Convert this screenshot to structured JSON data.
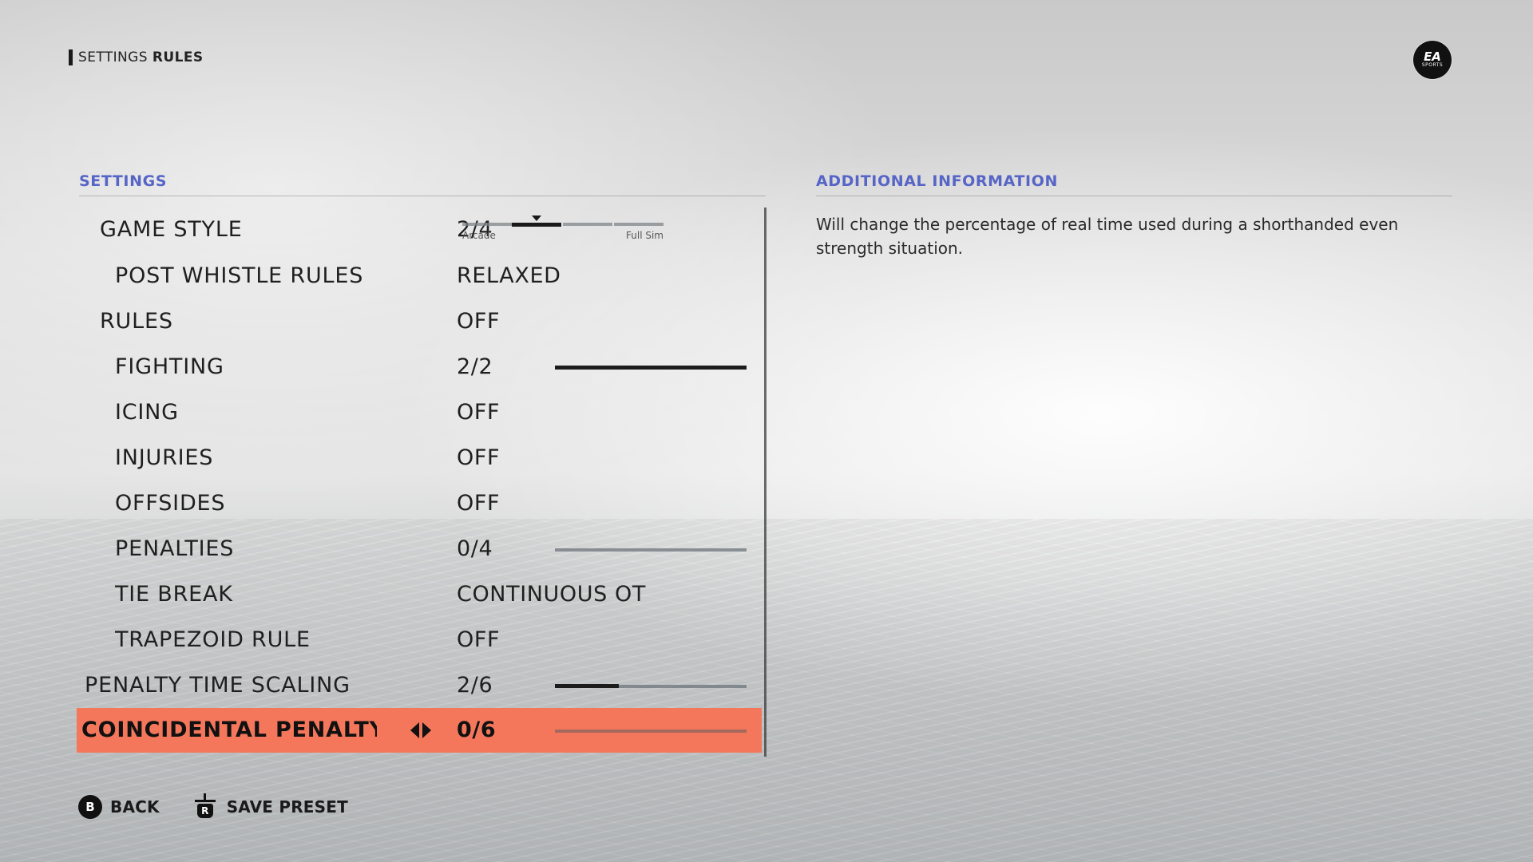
{
  "breadcrumb": {
    "section": "SETTINGS",
    "page": "RULES"
  },
  "logo": {
    "line1": "EA",
    "line2": "SPORTS"
  },
  "settings_header": "SETTINGS",
  "info_header": "ADDITIONAL INFORMATION",
  "info_text": "Will change the percentage of real time used during a shorthanded even strength situation.",
  "game_style": {
    "label": "GAME STYLE",
    "value": "2/4",
    "left_end": "Arcade",
    "right_end": "Full Sim",
    "level": 2,
    "max": 4
  },
  "rows": [
    {
      "label": "POST WHISTLE RULES",
      "value": "RELAXED"
    },
    {
      "label": "RULES",
      "value": "OFF"
    },
    {
      "label": "FIGHTING",
      "value": "2/2",
      "fraction": 1.0
    },
    {
      "label": "ICING",
      "value": "OFF"
    },
    {
      "label": "INJURIES",
      "value": "OFF"
    },
    {
      "label": "OFFSIDES",
      "value": "OFF"
    },
    {
      "label": "PENALTIES",
      "value": "0/4",
      "fraction": 0.0
    },
    {
      "label": "TIE BREAK",
      "value": "CONTINUOUS OT"
    },
    {
      "label": "TRAPEZOID RULE",
      "value": "OFF"
    },
    {
      "label": "PENALTY TIME SCALING",
      "value": "2/6",
      "fraction": 0.333
    },
    {
      "label": "COINCIDENTAL PENALTY TIME",
      "value": "0/6",
      "fraction": 0.0
    }
  ],
  "footer": {
    "back_button": "B",
    "back_label": "BACK",
    "save_button": "R",
    "save_label": "SAVE PRESET"
  },
  "colors": {
    "accent": "#5665c6",
    "selection": "#f5775b"
  }
}
